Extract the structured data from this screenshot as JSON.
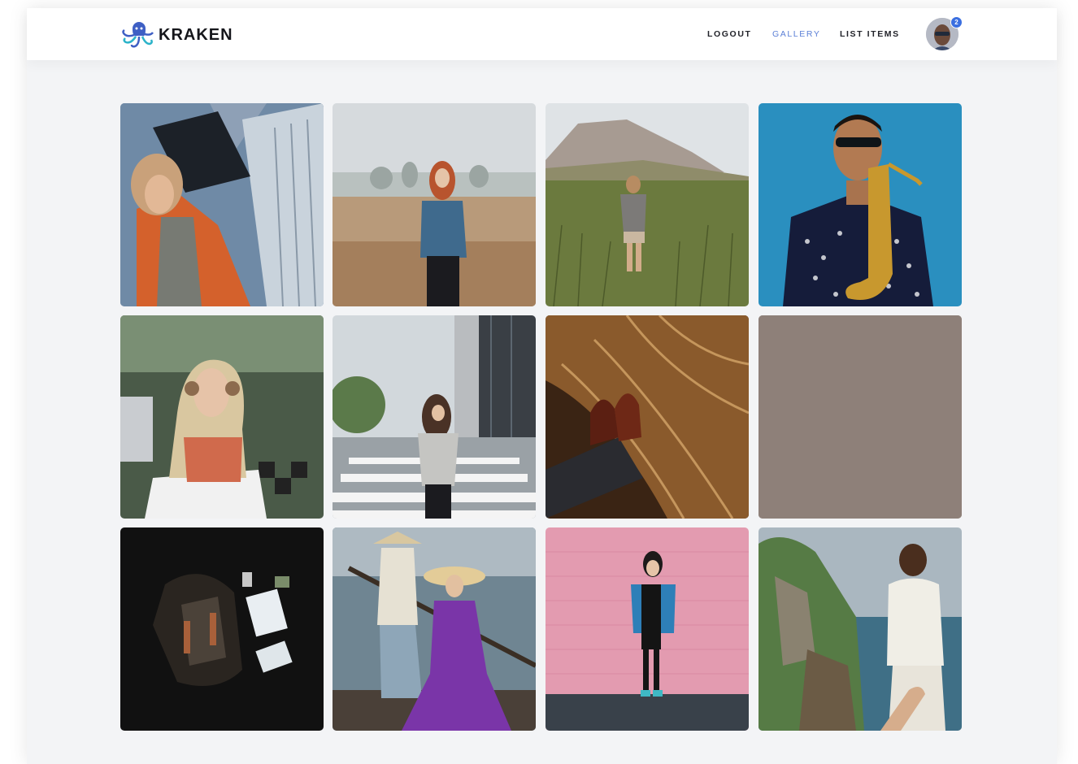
{
  "app": {
    "brand": "KRAKEN",
    "colors": {
      "accent": "#5b7fd6",
      "badge": "#3b6fe0",
      "page_bg": "#f3f4f6"
    }
  },
  "nav": {
    "links": [
      {
        "label": "LOGOUT",
        "active": false
      },
      {
        "label": "GALLERY",
        "active": true
      },
      {
        "label": "LIST ITEMS",
        "active": false
      }
    ],
    "avatar_badge": "2"
  },
  "gallery": {
    "photos": [
      {
        "icon": "photo-woman-orange-jacket",
        "color": "#d4612c"
      },
      {
        "icon": "photo-woman-field-fog",
        "color": "#3f6a8d"
      },
      {
        "icon": "photo-woman-grass-hills",
        "color": "#6b7a3e"
      },
      {
        "icon": "photo-man-saxophone",
        "color": "#2a8fbf"
      },
      {
        "icon": "photo-woman-headphones",
        "color": "#d9c7a0"
      },
      {
        "icon": "photo-woman-crosswalk",
        "color": "#9aa1a6"
      },
      {
        "icon": "photo-leather-shoes",
        "color": "#8a5a2c"
      },
      {
        "icon": "photo-placeholder",
        "color": "#8e8079"
      },
      {
        "icon": "photo-backpack-flatlay",
        "color": "#111111"
      },
      {
        "icon": "photo-woman-purple-dress",
        "color": "#7a35a8"
      },
      {
        "icon": "photo-woman-pink-wall",
        "color": "#e39bb0"
      },
      {
        "icon": "photo-woman-cliffs",
        "color": "#567b45"
      }
    ]
  }
}
